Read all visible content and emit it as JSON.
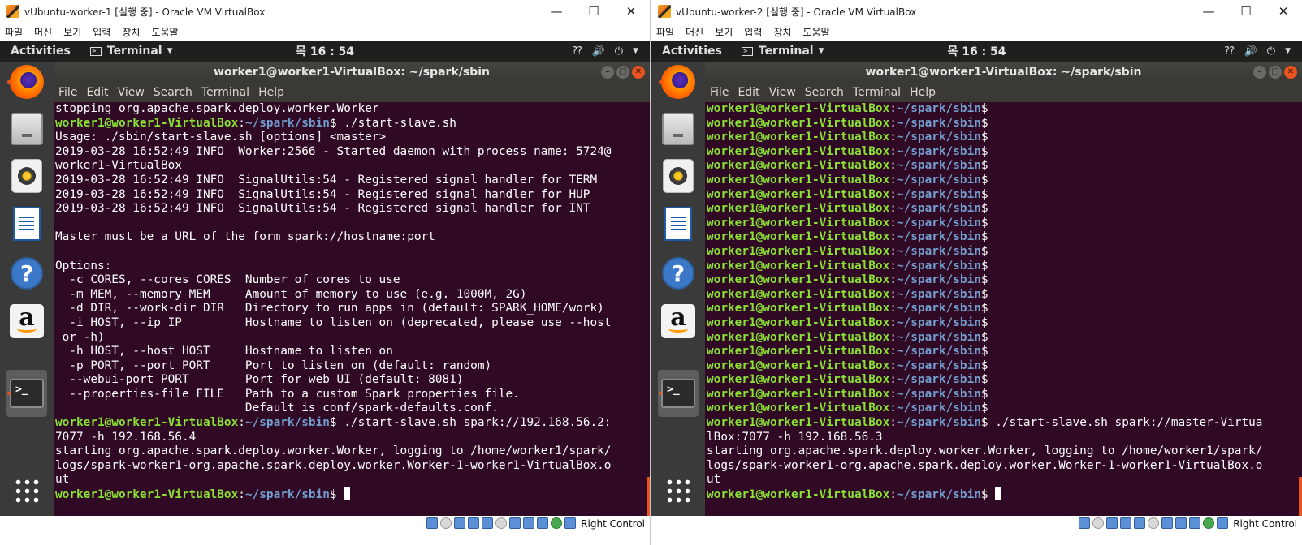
{
  "vbox_menus": [
    "파일",
    "머신",
    "보기",
    "입력",
    "장치",
    "도움말"
  ],
  "window_controls": {
    "minimize": "—",
    "maximize": "☐",
    "close": "✕"
  },
  "topbar": {
    "activities": "Activities",
    "app": "Terminal",
    "clock": "목 16 : 54"
  },
  "terminal": {
    "title": "worker1@worker1-VirtualBox: ~/spark/sbin",
    "menus": [
      "File",
      "Edit",
      "View",
      "Search",
      "Terminal",
      "Help"
    ]
  },
  "prompt": {
    "user": "worker1@worker1-VirtualBox",
    "path": "~/spark/sbin"
  },
  "host_key": "Right Control",
  "left": {
    "title": "vUbuntu-worker-1 [실행 중] - Oracle VM VirtualBox",
    "lines": [
      {
        "text": "stopping org.apache.spark.deploy.worker.Worker"
      },
      {
        "prompt": true,
        "cmd": " ./start-slave.sh"
      },
      {
        "text": "Usage: ./sbin/start-slave.sh [options] <master>"
      },
      {
        "text": "2019-03-28 16:52:49 INFO  Worker:2566 - Started daemon with process name: 5724@"
      },
      {
        "text": "worker1-VirtualBox"
      },
      {
        "text": "2019-03-28 16:52:49 INFO  SignalUtils:54 - Registered signal handler for TERM"
      },
      {
        "text": "2019-03-28 16:52:49 INFO  SignalUtils:54 - Registered signal handler for HUP"
      },
      {
        "text": "2019-03-28 16:52:49 INFO  SignalUtils:54 - Registered signal handler for INT"
      },
      {
        "text": ""
      },
      {
        "text": "Master must be a URL of the form spark://hostname:port"
      },
      {
        "text": ""
      },
      {
        "text": "Options:"
      },
      {
        "text": "  -c CORES, --cores CORES  Number of cores to use"
      },
      {
        "text": "  -m MEM, --memory MEM     Amount of memory to use (e.g. 1000M, 2G)"
      },
      {
        "text": "  -d DIR, --work-dir DIR   Directory to run apps in (default: SPARK_HOME/work)"
      },
      {
        "text": "  -i HOST, --ip IP         Hostname to listen on (deprecated, please use --host"
      },
      {
        "text": " or -h)"
      },
      {
        "text": "  -h HOST, --host HOST     Hostname to listen on"
      },
      {
        "text": "  -p PORT, --port PORT     Port to listen on (default: random)"
      },
      {
        "text": "  --webui-port PORT        Port for web UI (default: 8081)"
      },
      {
        "text": "  --properties-file FILE   Path to a custom Spark properties file."
      },
      {
        "text": "                           Default is conf/spark-defaults.conf."
      },
      {
        "prompt": true,
        "cmd": " ./start-slave.sh spark://192.168.56.2:"
      },
      {
        "text": "7077 -h 192.168.56.4"
      },
      {
        "text": "starting org.apache.spark.deploy.worker.Worker, logging to /home/worker1/spark/"
      },
      {
        "text": "logs/spark-worker1-org.apache.spark.deploy.worker.Worker-1-worker1-VirtualBox.o"
      },
      {
        "text": "ut"
      },
      {
        "prompt": true,
        "cmd": " ",
        "cursor": true
      }
    ]
  },
  "right": {
    "title": "vUbuntu-worker-2 [실행 중] - Oracle VM VirtualBox",
    "lines": [
      {
        "prompt": true,
        "cmd": ""
      },
      {
        "prompt": true,
        "cmd": ""
      },
      {
        "prompt": true,
        "cmd": ""
      },
      {
        "prompt": true,
        "cmd": ""
      },
      {
        "prompt": true,
        "cmd": ""
      },
      {
        "prompt": true,
        "cmd": ""
      },
      {
        "prompt": true,
        "cmd": ""
      },
      {
        "prompt": true,
        "cmd": ""
      },
      {
        "prompt": true,
        "cmd": ""
      },
      {
        "prompt": true,
        "cmd": ""
      },
      {
        "prompt": true,
        "cmd": ""
      },
      {
        "prompt": true,
        "cmd": ""
      },
      {
        "prompt": true,
        "cmd": ""
      },
      {
        "prompt": true,
        "cmd": ""
      },
      {
        "prompt": true,
        "cmd": ""
      },
      {
        "prompt": true,
        "cmd": ""
      },
      {
        "prompt": true,
        "cmd": ""
      },
      {
        "prompt": true,
        "cmd": ""
      },
      {
        "prompt": true,
        "cmd": ""
      },
      {
        "prompt": true,
        "cmd": ""
      },
      {
        "prompt": true,
        "cmd": ""
      },
      {
        "prompt": true,
        "cmd": ""
      },
      {
        "prompt": true,
        "cmd": " ./start-slave.sh spark://master-Virtua"
      },
      {
        "text": "lBox:7077 -h 192.168.56.3"
      },
      {
        "text": "starting org.apache.spark.deploy.worker.Worker, logging to /home/worker1/spark/"
      },
      {
        "text": "logs/spark-worker1-org.apache.spark.deploy.worker.Worker-1-worker1-VirtualBox.o"
      },
      {
        "text": "ut"
      },
      {
        "prompt": true,
        "cmd": " ",
        "cursor": true
      }
    ]
  },
  "colors": {
    "terminal_bg": "#300a24",
    "prompt_user": "#8ae234",
    "prompt_path": "#729fcf",
    "accent": "#e95420"
  },
  "dock_icons": [
    "firefox-icon",
    "files-icon",
    "rhythmbox-icon",
    "writer-icon",
    "help-icon",
    "amazon-icon",
    "terminal-icon",
    "show-apps-icon"
  ]
}
